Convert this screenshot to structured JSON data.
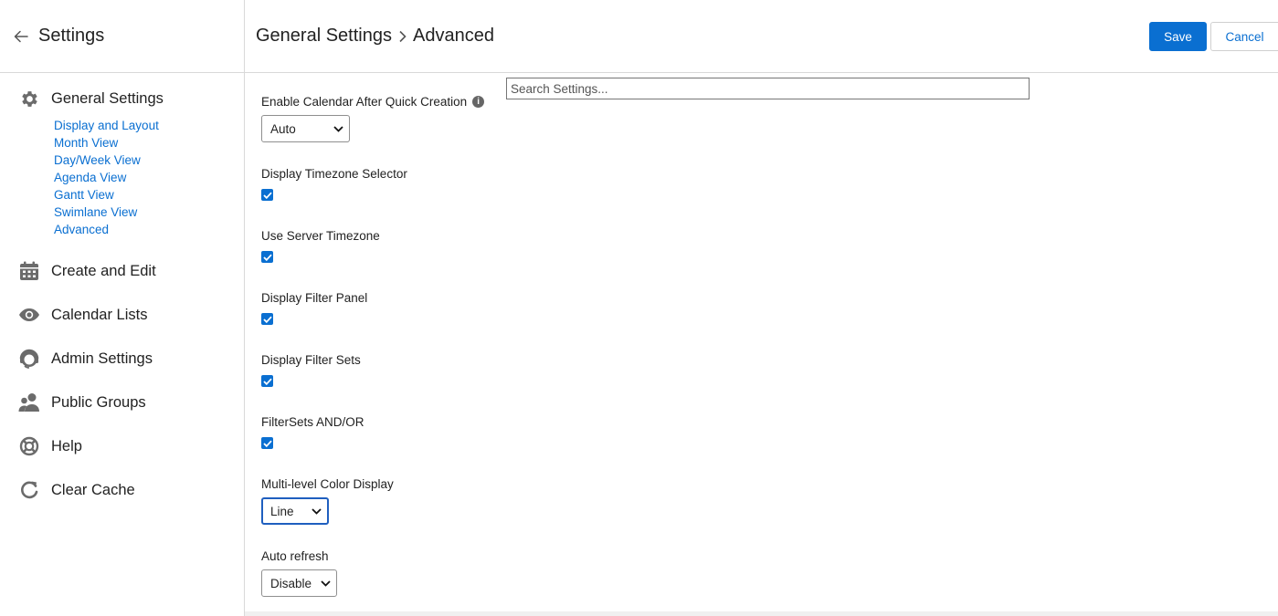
{
  "sidebar": {
    "title": "Settings",
    "back_icon": "arrow-left-icon",
    "sections": [
      {
        "label": "General Settings",
        "icon": "gear-icon"
      },
      {
        "label": "Create and Edit",
        "icon": "calendar-icon"
      },
      {
        "label": "Calendar Lists",
        "icon": "eye-icon"
      },
      {
        "label": "Admin Settings",
        "icon": "admin-headset-icon"
      },
      {
        "label": "Public Groups",
        "icon": "users-icon"
      },
      {
        "label": "Help",
        "icon": "lifebuoy-icon"
      },
      {
        "label": "Clear Cache",
        "icon": "refresh-icon"
      }
    ],
    "general_sub_items": [
      "Display and Layout",
      "Month View",
      "Day/Week View",
      "Agenda View",
      "Gantt View",
      "Swimlane View",
      "Advanced"
    ]
  },
  "header": {
    "breadcrumb_parent": "General Settings",
    "breadcrumb_current": "Advanced",
    "save_label": "Save",
    "cancel_label": "Cancel"
  },
  "search": {
    "placeholder": "Search Settings...",
    "value": ""
  },
  "settings": {
    "enable_calendar": {
      "label": "Enable Calendar After Quick Creation",
      "value": "Auto"
    },
    "timezone_selector": {
      "label": "Display Timezone Selector",
      "checked": true
    },
    "server_timezone": {
      "label": "Use Server Timezone",
      "checked": true
    },
    "filter_panel": {
      "label": "Display Filter Panel",
      "checked": true
    },
    "filter_sets": {
      "label": "Display Filter Sets",
      "checked": true
    },
    "filtersets_andor": {
      "label": "FilterSets AND/OR",
      "checked": true
    },
    "multilevel_color": {
      "label": "Multi-level Color Display",
      "value": "Line"
    },
    "auto_refresh": {
      "label": "Auto refresh",
      "value": "Disable"
    }
  },
  "colors": {
    "accent": "#0a6fd1",
    "text": "#222222",
    "border": "#d9d9d9",
    "icon": "#6b6b6b"
  }
}
